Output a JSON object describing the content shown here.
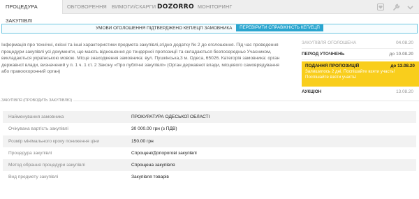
{
  "nav": {
    "tabs": [
      {
        "label": "ПРОЦЕДУРА ЗАКУПІВЛІ",
        "active": true
      },
      {
        "label": "ОБГОВОРЕННЯ",
        "active": false
      },
      {
        "label": "ВИМОГИ/СКАРГИ",
        "active": false
      },
      {
        "label": "DOZORRO",
        "active": false
      },
      {
        "label": "МОНІТОРИНГ",
        "active": false
      }
    ],
    "icons": [
      "heart-icon",
      "wrench-icon",
      "chevron-down-icon"
    ]
  },
  "banner": {
    "text": "УМОВИ ОГОЛОШЕННЯ ПІДТВЕРДЖЕНО КЕП/ЕЦП ЗАМОВНИКА",
    "button": "ПЕРЕВІРИТИ СПРАВЖНІСТЬ КЕП/ЕЦП",
    "border_color": "#6ec6e0",
    "button_color": "#2aa5cf"
  },
  "description": "Інформація про технічні, якісні та інші характеристики предмета закупівлі,згідно додатку № 2 до оголошення. Під час проведення процедури закупівлі усі документи, що мають відношення до тендерної пропозиції та складаються безпосередньо Учасником, викладаються українською мовою. Місце знаходження замовника: вул. Пушкінська,3 м. Одеса, 65026. Категорія замовника: орган державної влади, визначений у п. 1 ч. 1 ст. 2 Закону «Про публічні закупівлі» (Орган державної влади, місцевого самоврядування або правоохоронний орган)",
  "timeline": {
    "items": [
      {
        "label": "ЗАКУПІВЛЯ ОГОЛОШЕНА",
        "date": "04.08.20"
      },
      {
        "label": "ПЕРІОД УТОЧНЕНЬ",
        "date": "до 10.08.20"
      }
    ],
    "active": {
      "label": "ПОДАННЯ ПРОПОЗИЦІЙ",
      "date": "до 13.08.20",
      "note": "Залишилось 2 дні. Поспішайте взяти участь! Поспішайте взяти участь!",
      "color": "#f9ce1c"
    },
    "auction": {
      "label": "АУКЦІОН",
      "date": "13.08.20"
    }
  },
  "section_label": "ЗАКУПІВЛЯ (ПРОВОДИТЬ ЗАКУПІВЛЮ)",
  "info": [
    {
      "label": "Найменування замовника",
      "value": "ПРОКУРАТУРА ОДЕСЬКОЇ ОБЛАСТІ"
    },
    {
      "label": "Очікувана вартість закупівлі",
      "value": "30 000.00 грн (з ПДВ)"
    },
    {
      "label": "Розмір мінімального кроку пониження ціни",
      "value": "150.00 грн"
    },
    {
      "label": "Процедура закупівлі",
      "value": "Спрощені/Допорогові закупівлі"
    },
    {
      "label": "Метод обрання процедури закупівлі",
      "value": "Спрощена закупівля"
    },
    {
      "label": "Вид предмету закупівлі",
      "value": "Закупівля товарів"
    }
  ]
}
